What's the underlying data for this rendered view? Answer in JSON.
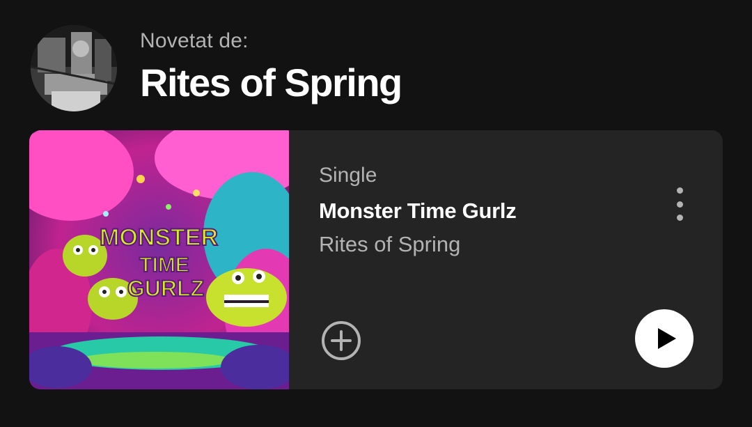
{
  "header": {
    "subtitle": "Novetat de:",
    "title": "Rites of Spring",
    "avatar_icon": "artist-avatar"
  },
  "release": {
    "type": "Single",
    "title": "Monster Time Gurlz",
    "artist": "Rites of Spring",
    "cover_text": [
      "MONSTER",
      "TIME",
      "GURLZ"
    ],
    "more_icon": "more-vertical-icon",
    "add_icon": "plus-circle-icon",
    "play_icon": "play-icon"
  },
  "colors": {
    "background": "#121212",
    "card": "#242424",
    "text_primary": "#ffffff",
    "text_secondary": "#b3b3b3"
  }
}
